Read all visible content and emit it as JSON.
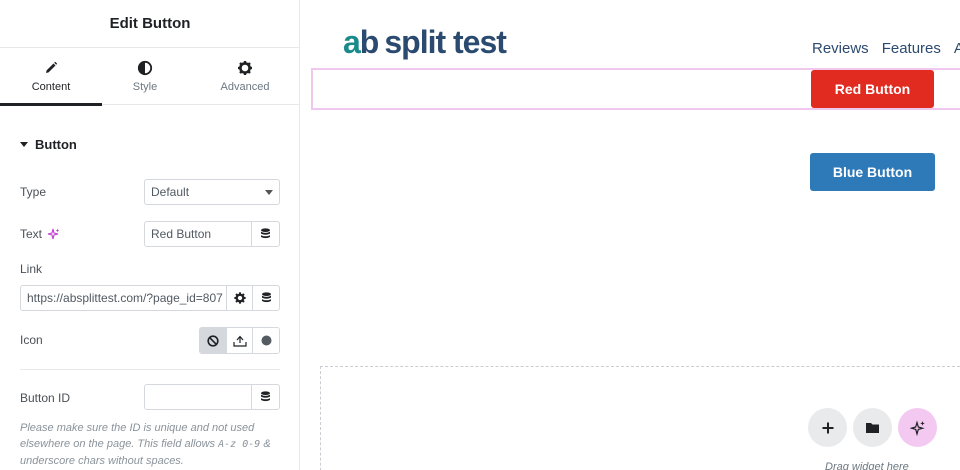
{
  "panel": {
    "title": "Edit Button",
    "tabs": [
      {
        "label": "Content",
        "icon": "pencil-icon",
        "active": true
      },
      {
        "label": "Style",
        "icon": "half-circle-icon",
        "active": false
      },
      {
        "label": "Advanced",
        "icon": "gear-icon",
        "active": false
      }
    ],
    "section_title": "Button",
    "fields": {
      "type": {
        "label": "Type",
        "value": "Default"
      },
      "text": {
        "label": "Text",
        "value": "Red Button"
      },
      "link": {
        "label": "Link",
        "value": "https://absplittest.com/?page_id=807"
      },
      "icon": {
        "label": "Icon"
      },
      "button_id": {
        "label": "Button ID",
        "value": ""
      }
    },
    "help_text": {
      "part1": "Please make sure the ID is unique and not used elsewhere on the page. This field allows ",
      "code1": "A-z 0-9",
      "part2": " & underscore chars without spaces."
    }
  },
  "canvas": {
    "logo": {
      "a": "a",
      "b": "b",
      "rest": "split test"
    },
    "nav": [
      "Reviews",
      "Features",
      "A"
    ],
    "red_button_label": "Red Button",
    "blue_button_label": "Blue Button",
    "drag_hint": "Drag widget here"
  },
  "colors": {
    "red_button": "#e22b20",
    "blue_button": "#2e7ab9",
    "selection_outline": "#f0c8ee",
    "ai_accent": "#c13fd0",
    "logo_teal": "#1a8a8a",
    "logo_navy": "#2b4a6f"
  }
}
